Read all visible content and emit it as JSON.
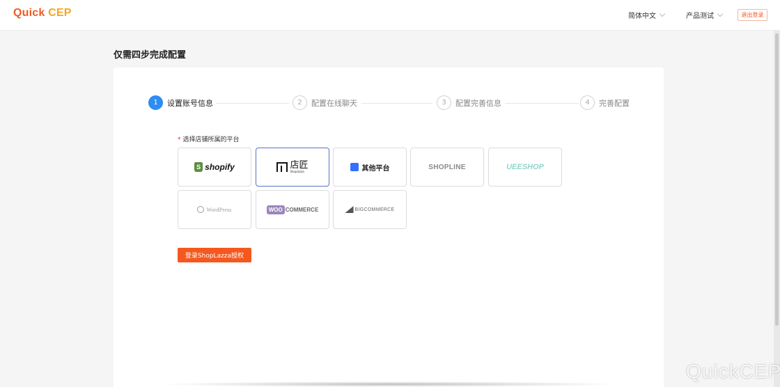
{
  "header": {
    "logo_prefix": "Quick",
    "logo_suffix": "CEP",
    "language": "简体中文",
    "account": "产品测试",
    "logout_label": "退出登录"
  },
  "page": {
    "title": "仅需四步完成配置"
  },
  "steps": [
    {
      "num": "1",
      "label": "设置账号信息",
      "active": true
    },
    {
      "num": "2",
      "label": "配置在线聊天",
      "active": false
    },
    {
      "num": "3",
      "label": "配置完善信息",
      "active": false
    },
    {
      "num": "4",
      "label": "完善配置",
      "active": false
    }
  ],
  "platform_field": {
    "required_mark": "*",
    "label": "选择店铺所属的平台"
  },
  "platforms": {
    "shopify": {
      "label": "shopify",
      "icon": "shopify-bag-icon",
      "icon_glyph": "S"
    },
    "shoplazza": {
      "label_cn": "店匠",
      "label_en": "Shoplazza",
      "icon": "shoplazza-logo-icon",
      "selected": true
    },
    "other": {
      "label": "其他平台",
      "icon": "shopping-bag-icon"
    },
    "shopline": {
      "label": "SHOPLINE"
    },
    "ueeshop": {
      "label": "UEESHOP"
    },
    "wordpress": {
      "label": "WordPress",
      "icon": "wordpress-icon"
    },
    "woocommerce": {
      "label_a": "WOO",
      "label_b": "COMMERCE"
    },
    "bigcommerce": {
      "label": "BIGCOMMERCE",
      "icon": "bigcommerce-icon"
    }
  },
  "auth_button": {
    "label": "登录ShopLazza授权"
  },
  "watermark": "QuickCEP",
  "colors": {
    "brand": "#f05a23",
    "step_active": "#2f8cf0",
    "selected_border": "#5872c9",
    "button": "#f5581e"
  }
}
